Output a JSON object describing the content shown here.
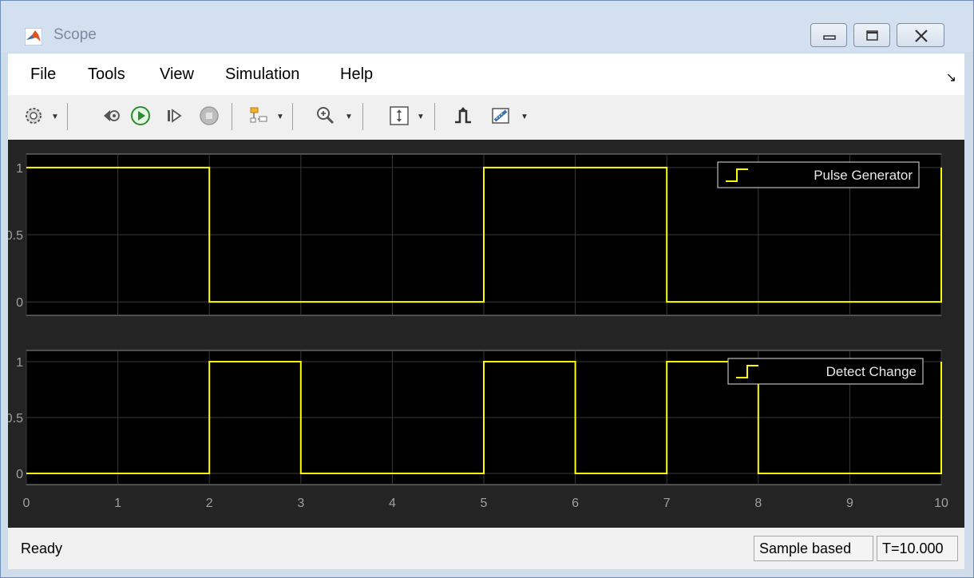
{
  "window": {
    "title": "Scope"
  },
  "menu": {
    "items": [
      "File",
      "Tools",
      "View",
      "Simulation",
      "Help"
    ]
  },
  "toolbar": {
    "icons": [
      "settings-icon",
      "step-back-icon",
      "run-icon",
      "step-forward-icon",
      "stop-icon",
      "signal-highlight-icon",
      "zoom-in-icon",
      "autoscale-icon",
      "triggers-icon",
      "measurements-icon"
    ]
  },
  "status": {
    "ready": "Ready",
    "mode": "Sample based",
    "time": "T=10.000"
  },
  "colors": {
    "signal": "#ffff00",
    "axes_bg": "#000000",
    "figure_bg": "#242424",
    "grid": "#3a3a3a",
    "axis_text": "#a0a0a0"
  },
  "chart_data": [
    {
      "type": "line",
      "legend": "top-right",
      "grid": true,
      "xlim": [
        0,
        10
      ],
      "ylim": [
        -0.1,
        1.1
      ],
      "yticks": [
        "0",
        "0.5",
        "1"
      ],
      "xticks": [],
      "series": [
        {
          "name": "Pulse Generator",
          "step": true,
          "x": [
            0,
            2,
            5,
            7,
            10
          ],
          "y": [
            1,
            0,
            1,
            0,
            1
          ]
        }
      ]
    },
    {
      "type": "line",
      "legend": "top-right",
      "grid": true,
      "xlim": [
        0,
        10
      ],
      "ylim": [
        -0.1,
        1.1
      ],
      "yticks": [
        "0",
        "0.5",
        "1"
      ],
      "xticks": [
        "0",
        "1",
        "2",
        "3",
        "4",
        "5",
        "6",
        "7",
        "8",
        "9",
        "10"
      ],
      "series": [
        {
          "name": "Detect Change",
          "step": true,
          "x": [
            0,
            2,
            3,
            5,
            6,
            7,
            8,
            10
          ],
          "y": [
            0,
            1,
            0,
            1,
            0,
            1,
            0,
            1
          ]
        }
      ]
    }
  ]
}
